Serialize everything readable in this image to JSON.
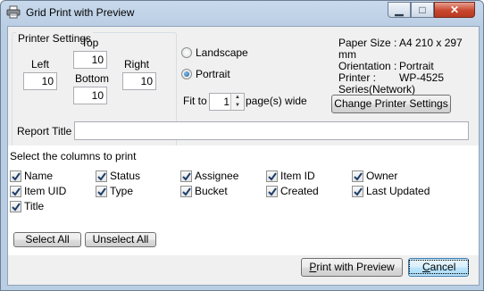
{
  "window": {
    "title": "Grid Print with Preview",
    "min_glyph": "▁",
    "max_glyph": "□",
    "close_glyph": "✕"
  },
  "printer_settings": {
    "group_title": "Printer Settings",
    "top_label": "Top",
    "top_value": "10",
    "left_label": "Left",
    "left_value": "10",
    "right_label": "Right",
    "right_value": "10",
    "bottom_label": "Bottom",
    "bottom_value": "10"
  },
  "orientation": {
    "landscape_label": "Landscape",
    "portrait_label": "Portrait",
    "selected": "Portrait"
  },
  "fit": {
    "prefix": "Fit to",
    "value": "1",
    "suffix": "page(s) wide"
  },
  "paper_info": {
    "paper_size_label": "Paper Size :",
    "paper_size_value": "A4 210 x 297",
    "paper_size_cont": "mm",
    "orientation_label": "Orientation :",
    "orientation_value": "Portrait",
    "printer_label": "Printer :",
    "printer_value": "WP-4525",
    "printer_cont": "Series(Network)"
  },
  "change_button": "Change Printer Settings",
  "report_title": {
    "label": "Report Title",
    "value": ""
  },
  "columns": {
    "header": "Select the columns to print",
    "items": [
      {
        "label": "Name",
        "checked": true
      },
      {
        "label": "Status",
        "checked": true
      },
      {
        "label": "Assignee",
        "checked": true
      },
      {
        "label": "Item ID",
        "checked": true
      },
      {
        "label": "Owner",
        "checked": true
      },
      {
        "label": "Item UID",
        "checked": true
      },
      {
        "label": "Type",
        "checked": true
      },
      {
        "label": "Bucket",
        "checked": true
      },
      {
        "label": "Created",
        "checked": true
      },
      {
        "label": "Last Updated",
        "checked": true
      },
      {
        "label": "Title",
        "checked": true
      }
    ]
  },
  "select_all": "Select All",
  "unselect_all": "Unselect All",
  "print_preview": {
    "underlined": "P",
    "rest": "rint with Preview"
  },
  "cancel": {
    "underlined": "C",
    "rest": "ancel"
  }
}
